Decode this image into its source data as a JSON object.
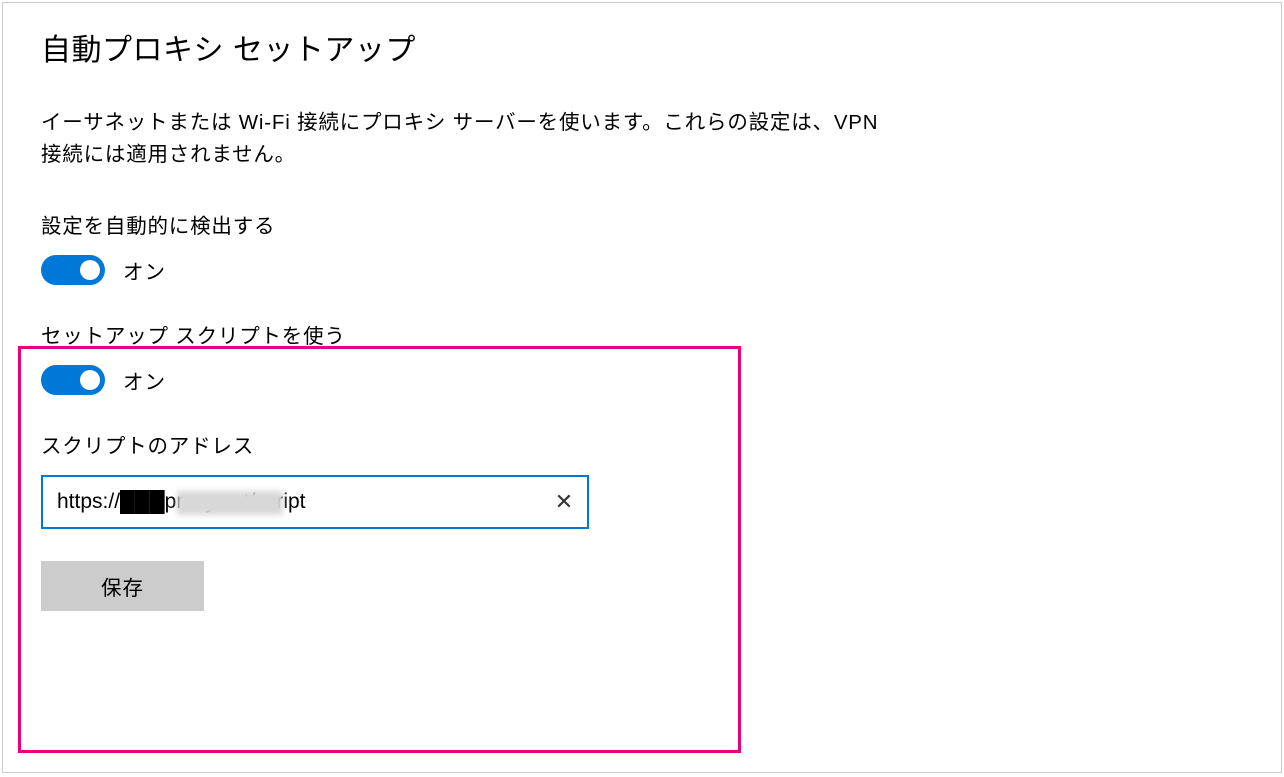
{
  "page": {
    "title": "自動プロキシ セットアップ",
    "description": "イーサネットまたは Wi-Fi 接続にプロキシ サーバーを使います。これらの設定は、VPN 接続には適用されません。"
  },
  "auto_detect": {
    "label": "設定を自動的に検出する",
    "state_text": "オン",
    "on": true
  },
  "use_script": {
    "label": "セットアップ スクリプトを使う",
    "state_text": "オン",
    "on": true
  },
  "script_address": {
    "label": "スクリプトのアドレス",
    "value": "https://███proxy.net/script"
  },
  "save_button": {
    "label": "保存"
  },
  "colors": {
    "accent": "#0078D7",
    "highlight": "#E6007E",
    "button_bg": "#cccccc"
  }
}
